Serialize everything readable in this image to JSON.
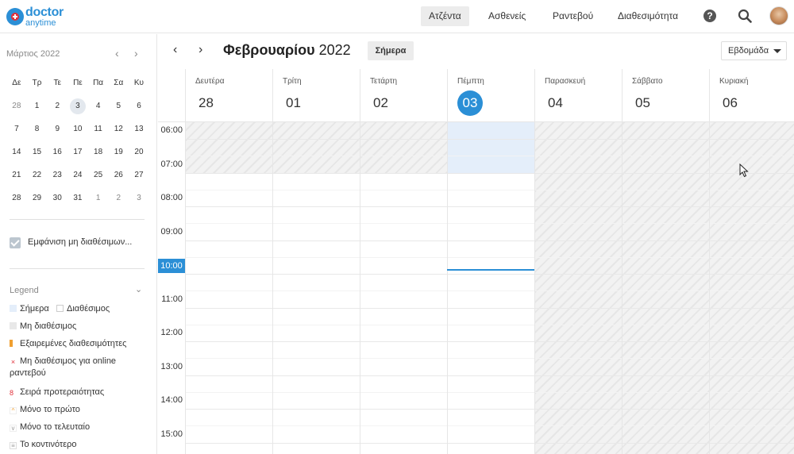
{
  "brand": {
    "line1": "doctor",
    "line2": "anytime"
  },
  "nav": {
    "agenda": "Ατζέντα",
    "patients": "Ασθενείς",
    "appointments": "Ραντεβού",
    "availability": "Διαθεσιμότητα"
  },
  "mini_calendar": {
    "title": "Μάρτιος 2022",
    "prev": "‹",
    "next": "›",
    "weekdays": [
      "Δε",
      "Τρ",
      "Τε",
      "Πε",
      "Πα",
      "Σα",
      "Κυ"
    ],
    "weeks": [
      [
        "28",
        "1",
        "2",
        "3",
        "4",
        "5",
        "6"
      ],
      [
        "7",
        "8",
        "9",
        "10",
        "11",
        "12",
        "13"
      ],
      [
        "14",
        "15",
        "16",
        "17",
        "18",
        "19",
        "20"
      ],
      [
        "21",
        "22",
        "23",
        "24",
        "25",
        "26",
        "27"
      ],
      [
        "28",
        "29",
        "30",
        "31",
        "1",
        "2",
        "3"
      ]
    ]
  },
  "show_unavailable": "Εμφάνιση μη διαθέσιμων...",
  "legend": {
    "title": "Legend",
    "today": "Σήμερα",
    "available": "Διαθέσιμος",
    "unavailable": "Μη διαθέσιμος",
    "excluded": "Εξαιρεμένες διαθεσιμότητες",
    "not_online": "Μη διαθέσιμος για online ραντεβού",
    "priority": "Σειρά προτεραιότητας",
    "first_only": "Μόνο το πρώτο",
    "last_only": "Μόνο το τελευταίο",
    "nearest": "Το κοντινότερο"
  },
  "header": {
    "month_bold": "Φεβρουαρίου",
    "year": "2022",
    "today_btn": "Σήμερα",
    "view": "Εβδομάδα",
    "prev": "‹",
    "next": "›"
  },
  "days": [
    {
      "name": "Δευτέρα",
      "num": "28"
    },
    {
      "name": "Τρίτη",
      "num": "01"
    },
    {
      "name": "Τετάρτη",
      "num": "02"
    },
    {
      "name": "Πέμπτη",
      "num": "03"
    },
    {
      "name": "Παρασκευή",
      "num": "04"
    },
    {
      "name": "Σάββατο",
      "num": "05"
    },
    {
      "name": "Κυριακή",
      "num": "06"
    }
  ],
  "times": [
    "06:00",
    "07:00",
    "08:00",
    "09:00",
    "10:00",
    "11:00",
    "12:00",
    "13:00",
    "14:00",
    "15:00"
  ],
  "colors": {
    "accent": "#2b8fd6",
    "hatch": "#e6e6e6",
    "today_bg": "#e4eefa"
  }
}
